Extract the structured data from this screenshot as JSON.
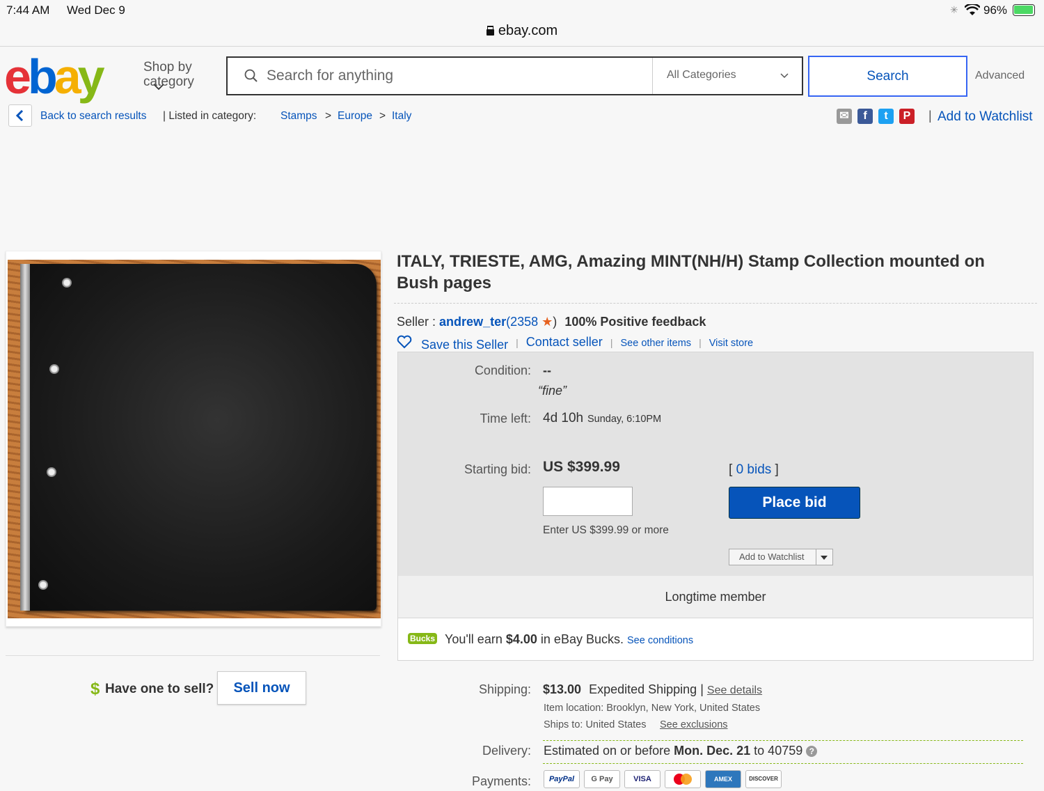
{
  "status_bar": {
    "time": "7:44 AM",
    "date": "Wed Dec 9",
    "battery": "96%"
  },
  "browser": {
    "url": "ebay.com"
  },
  "header": {
    "logo": {
      "e": "e",
      "b": "b",
      "a": "a",
      "y": "y"
    },
    "shop_by_line1": "Shop by",
    "shop_by_line2": "category",
    "search_placeholder": "Search for anything",
    "category_select": "All Categories",
    "search_button": "Search",
    "advanced": "Advanced"
  },
  "breadcrumb": {
    "back": "Back to search results",
    "listed_in": "| Listed in category:",
    "items": [
      "Stamps",
      "Europe",
      "Italy"
    ],
    "separator": ">",
    "add_to_watchlist": "Add to Watchlist"
  },
  "listing": {
    "title": "ITALY, TRIESTE, AMG, Amazing MINT(NH/H) Stamp Collection mounted on Bush pages",
    "seller_label": "Seller :",
    "seller_name": "andrew_ter",
    "feedback_open": "(2358",
    "feedback_close": ")",
    "positive": "100% Positive feedback",
    "save_seller": "Save this Seller",
    "contact_seller": "Contact seller",
    "see_other": "See other items",
    "visit_store": "Visit store"
  },
  "bid": {
    "condition_label": "Condition:",
    "condition_value": "--",
    "condition_note": "“fine”",
    "time_left_label": "Time left:",
    "time_left": "4d 10h",
    "end_time": "Sunday, 6:10PM",
    "starting_bid_label": "Starting bid:",
    "starting_bid": "US $399.99",
    "bids_open": "[",
    "bids": "0 bids",
    "bids_close": "]",
    "place_bid": "Place bid",
    "enter_hint": "Enter US $399.99 or more",
    "add_watchlist_small": "Add to Watchlist",
    "longtime": "Longtime member",
    "bucks_badge": "Bucks",
    "bucks_text_pre": "You'll earn",
    "bucks_amount": "$4.00",
    "bucks_text_post": "in eBay Bucks.",
    "see_conditions": "See conditions"
  },
  "sell": {
    "have_one": "Have one to sell?",
    "dollar": "$",
    "sell_now": "Sell now"
  },
  "shipping": {
    "label": "Shipping:",
    "cost": "$13.00",
    "method": "Expedited Shipping |",
    "see_details": "See details",
    "location": "Item location:  Brooklyn, New York, United States",
    "ships_to": "Ships to:  United States",
    "see_exclusions": "See exclusions",
    "delivery_label": "Delivery:",
    "delivery_pre": "Estimated on or before",
    "delivery_date": "Mon. Dec. 21",
    "delivery_post": "to 40759",
    "payments_label": "Payments:",
    "payment_methods": [
      "PayPal",
      "G Pay",
      "VISA",
      "",
      "AMEX",
      "DISCOVER"
    ]
  },
  "colors": {
    "link": "#0654ba",
    "place_bid": "#0654ba",
    "bucks": "#86b817"
  }
}
